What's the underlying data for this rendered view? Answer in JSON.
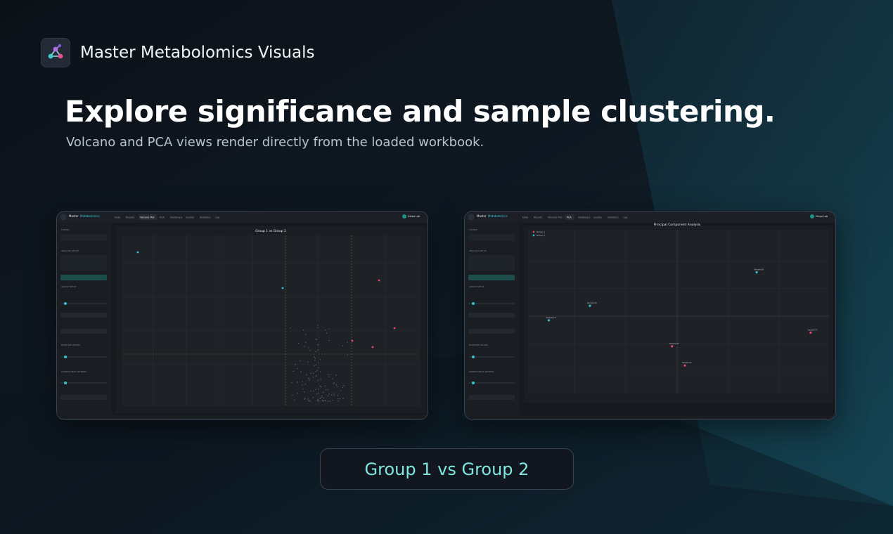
{
  "brand": {
    "name": "Master Metabolomics Visuals",
    "icon": "molecule-network-icon"
  },
  "hero": {
    "headline": "Explore significance and sample clustering.",
    "subline": "Volcano and PCA views render directly from the loaded workbook."
  },
  "screens": {
    "app_brand": "Master",
    "app_brand_accent": "Metabolomics",
    "nav_tabs": [
      "Data",
      "Results",
      "Volcano Plot",
      "PCA",
      "Heatmaps",
      "Quality",
      "Statistics",
      "Log"
    ],
    "user_name": "Demo Lab",
    "sidebar_sections": [
      "FILTERS",
      "ANALYSIS SETUP",
      "GROUP SETUP",
      "BASELINE VALUES",
      "SIGNIFICANCE CRITERIA"
    ],
    "volcano": {
      "title": "Group 1 vs Group 2",
      "active_tab": "Volcano Plot"
    },
    "pca": {
      "title": "Principal Component Analysis",
      "active_tab": "PCA",
      "legend": [
        "Group 1",
        "Group 2"
      ],
      "colors": {
        "group1": "#e8456b",
        "group2": "#37c3d0"
      },
      "points": [
        {
          "label": "Sample 08",
          "group": 2,
          "pc1": 15.5,
          "pc2": 16
        },
        {
          "label": "Sample 06",
          "group": 2,
          "pc1": -17,
          "pc2": 3.8
        },
        {
          "label": "Sample 03",
          "group": 2,
          "pc1": -25,
          "pc2": -1.5
        },
        {
          "label": "Sample 07",
          "group": 1,
          "pc1": 26,
          "pc2": -6
        },
        {
          "label": "Sample 02",
          "group": 1,
          "pc1": -1,
          "pc2": -11
        },
        {
          "label": "Sample 01",
          "group": 1,
          "pc1": 1.5,
          "pc2": -18
        }
      ]
    }
  },
  "comparison_pill": {
    "label": "Group 1 vs Group 2"
  },
  "colors": {
    "accent": "#7fe7e0",
    "teal": "#1e8f86",
    "background": "#0b1118"
  }
}
